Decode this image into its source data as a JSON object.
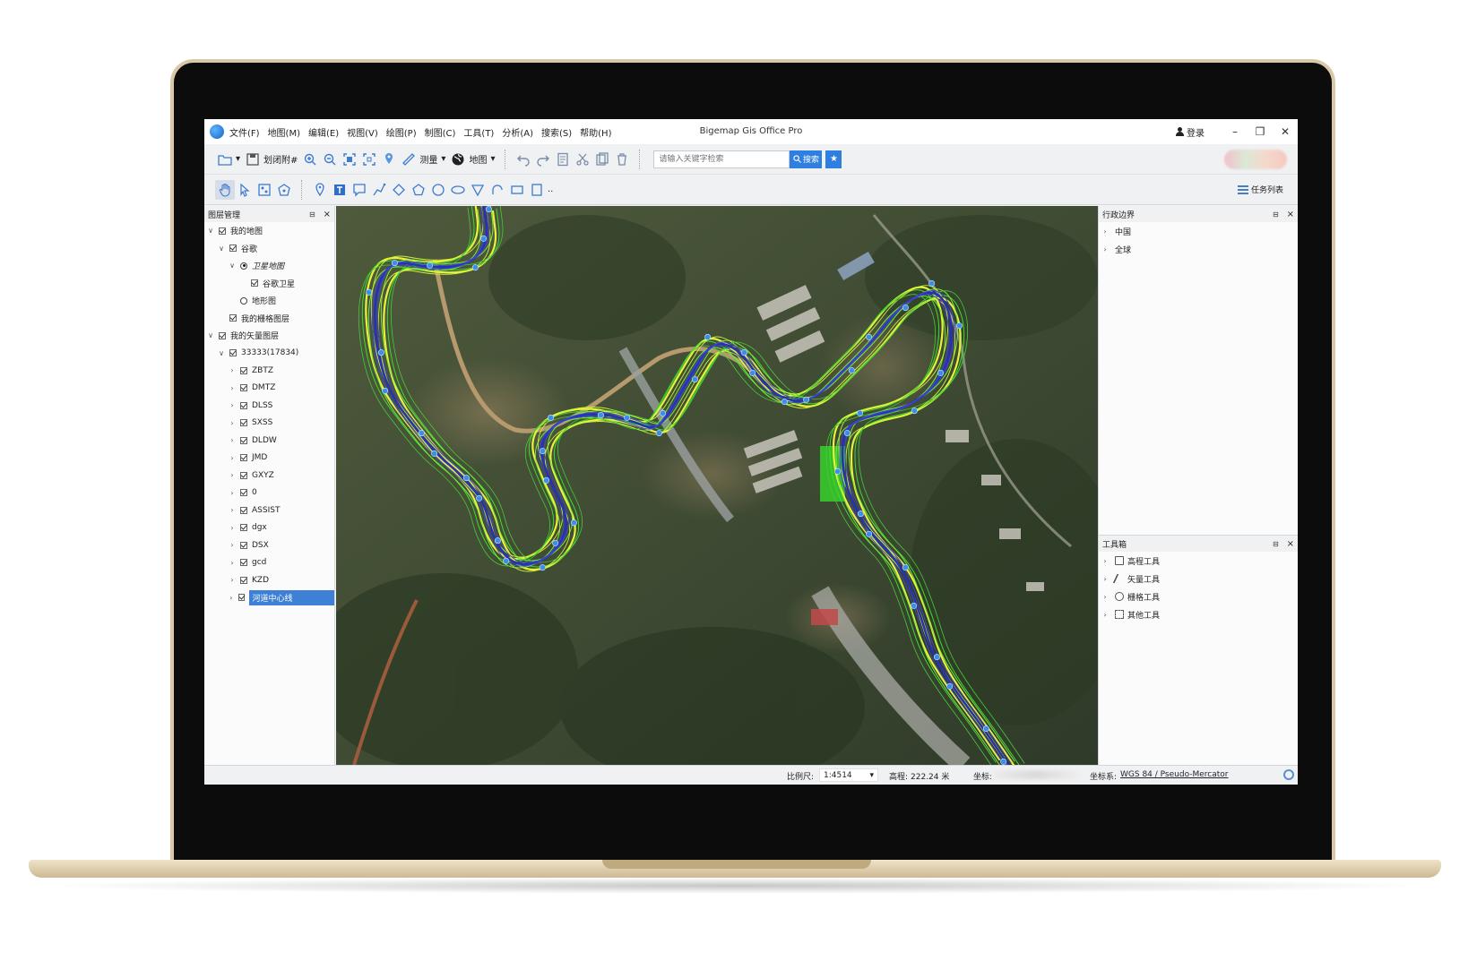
{
  "app": {
    "title": "Bigemap Gis Office Pro",
    "login_label": "登录",
    "window_buttons": [
      "–",
      "❐",
      "✕"
    ]
  },
  "menu": [
    "文件(F)",
    "地图(M)",
    "编辑(E)",
    "视图(V)",
    "绘图(P)",
    "制图(C)",
    "工具(T)",
    "分析(A)",
    "搜索(S)",
    "帮助(H)"
  ],
  "toolbar1": {
    "draw_label": "划闭附#",
    "measure_label": "测量",
    "map_label": "地图",
    "search_placeholder": "请输入关键字检索",
    "search_button": "搜索"
  },
  "toolbar2": {
    "more": "..",
    "tasklist_label": "任务列表"
  },
  "left_panel": {
    "title": "图层管理",
    "pin": "⊟",
    "close": "×",
    "tree": [
      {
        "label": "我的地图",
        "chev": "∨",
        "ctrl": "cb",
        "on": true
      },
      {
        "label": "谷歌",
        "chev": "∨",
        "ctrl": "cb",
        "on": true
      },
      {
        "label": "卫星地图",
        "chev": "∨",
        "ctrl": "radio",
        "on": true,
        "italic": true
      },
      {
        "label": "谷歌卫星",
        "chev": "",
        "ctrl": "cb",
        "on": true
      },
      {
        "label": "地形图",
        "chev": "",
        "ctrl": "radio",
        "on": false
      },
      {
        "label": "我的栅格图层",
        "chev": "",
        "ctrl": "cb",
        "on": true
      },
      {
        "label": "我的矢量图层",
        "chev": "∨",
        "ctrl": "cb",
        "on": true
      },
      {
        "label": "33333(17834)",
        "chev": "∨",
        "ctrl": "cb",
        "on": true
      },
      {
        "label": "ZBTZ",
        "chev": "›",
        "ctrl": "cb",
        "on": true
      },
      {
        "label": "DMTZ",
        "chev": "›",
        "ctrl": "cb",
        "on": true
      },
      {
        "label": "DLSS",
        "chev": "›",
        "ctrl": "cb",
        "on": true
      },
      {
        "label": "SXSS",
        "chev": "›",
        "ctrl": "cb",
        "on": true
      },
      {
        "label": "DLDW",
        "chev": "›",
        "ctrl": "cb",
        "on": true
      },
      {
        "label": "JMD",
        "chev": "›",
        "ctrl": "cb",
        "on": true
      },
      {
        "label": "GXYZ",
        "chev": "›",
        "ctrl": "cb",
        "on": true
      },
      {
        "label": "0",
        "chev": "›",
        "ctrl": "cb",
        "on": true
      },
      {
        "label": "ASSIST",
        "chev": "›",
        "ctrl": "cb",
        "on": true
      },
      {
        "label": "dgx",
        "chev": "›",
        "ctrl": "cb",
        "on": true
      },
      {
        "label": "DSX",
        "chev": "›",
        "ctrl": "cb",
        "on": true
      },
      {
        "label": "gcd",
        "chev": "›",
        "ctrl": "cb",
        "on": true
      },
      {
        "label": "KZD",
        "chev": "›",
        "ctrl": "cb",
        "on": true
      },
      {
        "label": "河道中心线",
        "chev": "›",
        "ctrl": "cb",
        "on": true,
        "selected": true
      }
    ]
  },
  "right_panel": {
    "admin_title": "行政边界",
    "admin_items": [
      "中国",
      "全球"
    ],
    "toolbox_title": "工具箱",
    "toolbox_items": [
      "高程工具",
      "矢量工具",
      "栅格工具",
      "其他工具"
    ],
    "pin": "⊟",
    "close": "×"
  },
  "statusbar": {
    "scale_label": "比例尺:",
    "scale_value": "1:4514",
    "elevation_label": "高程:",
    "elevation_value": "222.24 米",
    "coord_label": "坐标:",
    "crs_label": "坐标系:",
    "crs_value": "WGS 84 / Pseudo-Mercator"
  },
  "colors": {
    "accent": "#2f7fe0",
    "selection": "#3d80d6",
    "river_center": "#2a2fb8",
    "contour_yellow": "#e8f23a",
    "contour_green": "#3ddc2a",
    "point_blue": "#3a8fe8"
  }
}
